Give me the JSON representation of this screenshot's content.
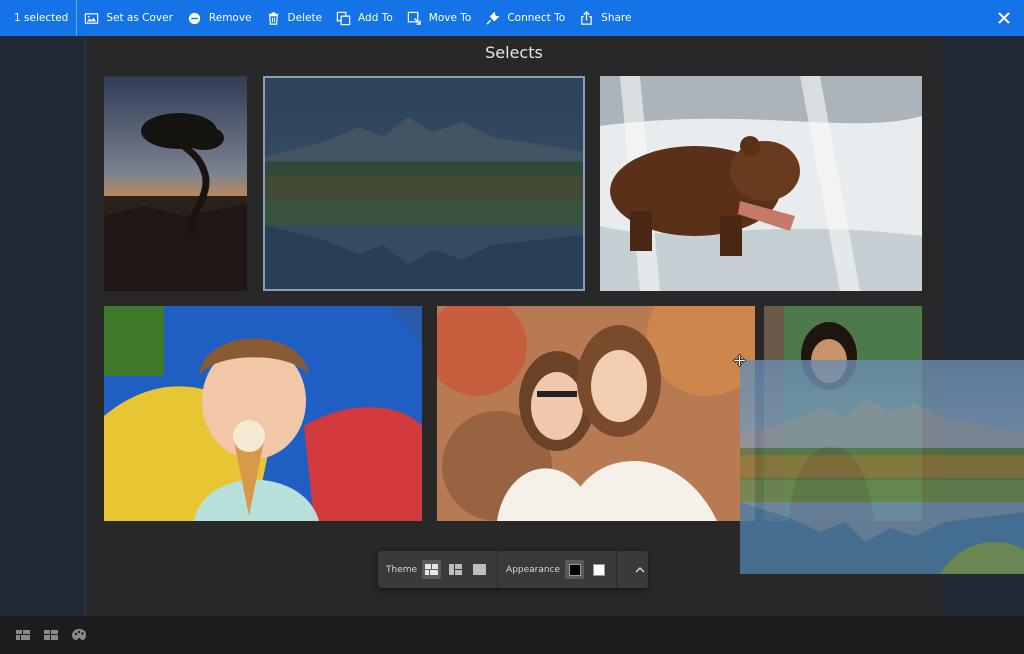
{
  "actionbar": {
    "selected": "1 selected",
    "actions": [
      "Set as Cover",
      "Remove",
      "Delete",
      "Add To",
      "Move To",
      "Connect To",
      "Share"
    ]
  },
  "album": {
    "title": "Selects"
  },
  "theme_bar": {
    "theme_label": "Theme",
    "appearance_label": "Appearance"
  },
  "icons": {
    "close": "close-icon",
    "bottom": [
      "grid-view-icon",
      "grid-view-alt-icon",
      "palette-icon"
    ]
  },
  "colors": {
    "accent": "#1473e6",
    "panel": "#1f2a36",
    "canvas": "#282828"
  }
}
